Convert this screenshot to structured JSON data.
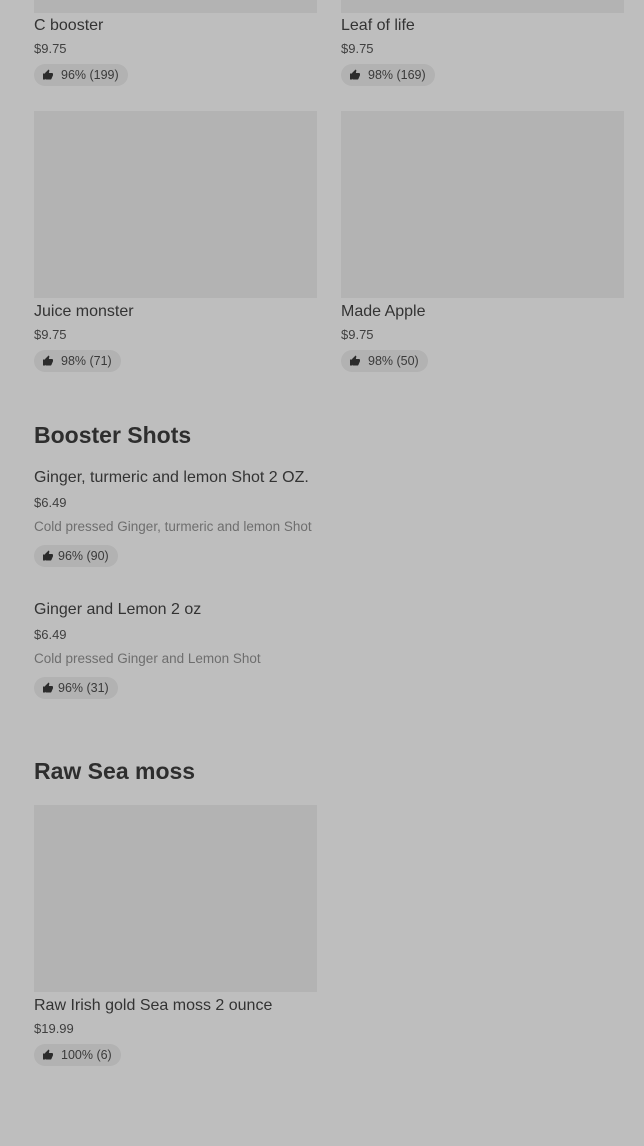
{
  "sections": {
    "booster_shots_title": "Booster Shots",
    "raw_sea_moss_title": "Raw Sea moss"
  },
  "grid_items": [
    {
      "name": "C booster",
      "price": "$9.75",
      "rating": "96% (199)"
    },
    {
      "name": "Leaf of life",
      "price": "$9.75",
      "rating": "98% (169)"
    },
    {
      "name": "Juice monster",
      "price": "$9.75",
      "rating": "98% (71)"
    },
    {
      "name": "Made Apple",
      "price": "$9.75",
      "rating": "98% (50)"
    }
  ],
  "booster_items": [
    {
      "name": "Ginger, turmeric and lemon Shot 2 OZ.",
      "price": "$6.49",
      "description": "Cold pressed Ginger, turmeric and lemon Shot",
      "rating": "96% (90)"
    },
    {
      "name": "Ginger and Lemon 2 oz",
      "price": "$6.49",
      "description": "Cold pressed Ginger and Lemon Shot",
      "rating": "96% (31)"
    }
  ],
  "sea_moss_items": [
    {
      "name": "Raw Irish gold Sea moss 2 ounce",
      "price": "$19.99",
      "rating": "100% (6)"
    }
  ],
  "icons": {
    "rating": "thumbs-up-icon"
  }
}
